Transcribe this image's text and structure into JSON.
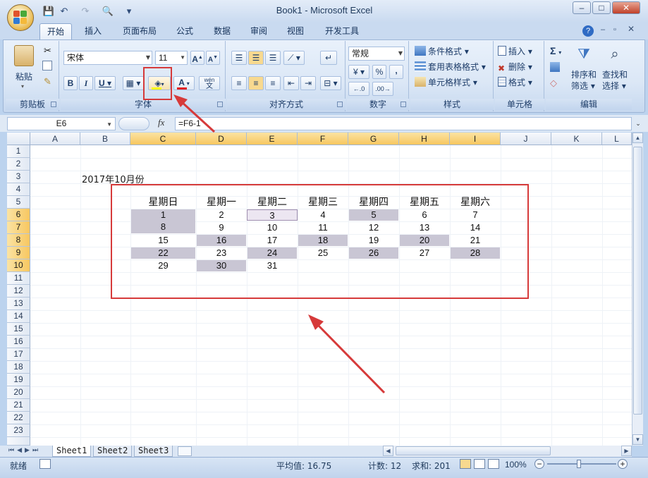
{
  "window": {
    "title": "Book1 - Microsoft Excel",
    "minimize": "–",
    "maximize": "□",
    "close": "✕"
  },
  "qat": {
    "save": "💾",
    "undo": "↶",
    "redo": "↷",
    "preview": "🔍",
    "customize": "▾"
  },
  "tabs": [
    "开始",
    "插入",
    "页面布局",
    "公式",
    "数据",
    "审阅",
    "视图",
    "开发工具"
  ],
  "ribbon": {
    "clipboard": {
      "label": "剪贴板",
      "paste": "粘贴"
    },
    "font": {
      "label": "字体",
      "name": "宋体",
      "size": "11",
      "bold": "B",
      "italic": "I",
      "underline": "U",
      "font_color": "A",
      "phonetic": "wén"
    },
    "alignment": {
      "label": "对齐方式"
    },
    "number": {
      "label": "数字",
      "format": "常规",
      "percent": "%",
      "comma": ","
    },
    "styles": {
      "label": "样式",
      "conditional": "条件格式",
      "table": "套用表格格式",
      "cell_styles": "单元格样式"
    },
    "cells": {
      "label": "单元格",
      "insert": "插入",
      "delete": "删除",
      "format": "格式"
    },
    "editing": {
      "label": "编辑",
      "sum": "Σ",
      "sort": [
        "排序和",
        "筛选"
      ],
      "find": [
        "查找和",
        "选择"
      ]
    }
  },
  "formula_bar": {
    "name_box": "E6",
    "fx": "fx",
    "formula": "=F6-1"
  },
  "columns": [
    "A",
    "B",
    "C",
    "D",
    "E",
    "F",
    "G",
    "H",
    "I",
    "J",
    "K",
    "L"
  ],
  "rows": [
    "1",
    "2",
    "3",
    "4",
    "5",
    "6",
    "7",
    "8",
    "9",
    "10",
    "11",
    "12",
    "13",
    "14",
    "15",
    "16",
    "17",
    "18",
    "19",
    "20",
    "21",
    "22",
    "23"
  ],
  "sheet": {
    "title": "2017年10月份",
    "weekdays": [
      "星期日",
      "星期一",
      "星期二",
      "星期三",
      "星期四",
      "星期五",
      "星期六"
    ],
    "calendar_rows": [
      [
        "1",
        "2",
        "3",
        "4",
        "5",
        "6",
        "7"
      ],
      [
        "8",
        "9",
        "10",
        "11",
        "12",
        "13",
        "14"
      ],
      [
        "15",
        "16",
        "17",
        "18",
        "19",
        "20",
        "21"
      ],
      [
        "22",
        "23",
        "24",
        "25",
        "26",
        "27",
        "28"
      ],
      [
        "29",
        "30",
        "31",
        "",
        "",
        "",
        ""
      ]
    ]
  },
  "sheet_tabs": [
    "Sheet1",
    "Sheet2",
    "Sheet3"
  ],
  "status": {
    "ready": "就绪",
    "average": "平均值: 16.75",
    "count": "计数: 12",
    "sum": "求和: 201",
    "zoom": "100%"
  },
  "colors": {
    "shade": "#c9c6d4",
    "annotation": "#d63a3a",
    "selection_header": "#f7c760"
  }
}
